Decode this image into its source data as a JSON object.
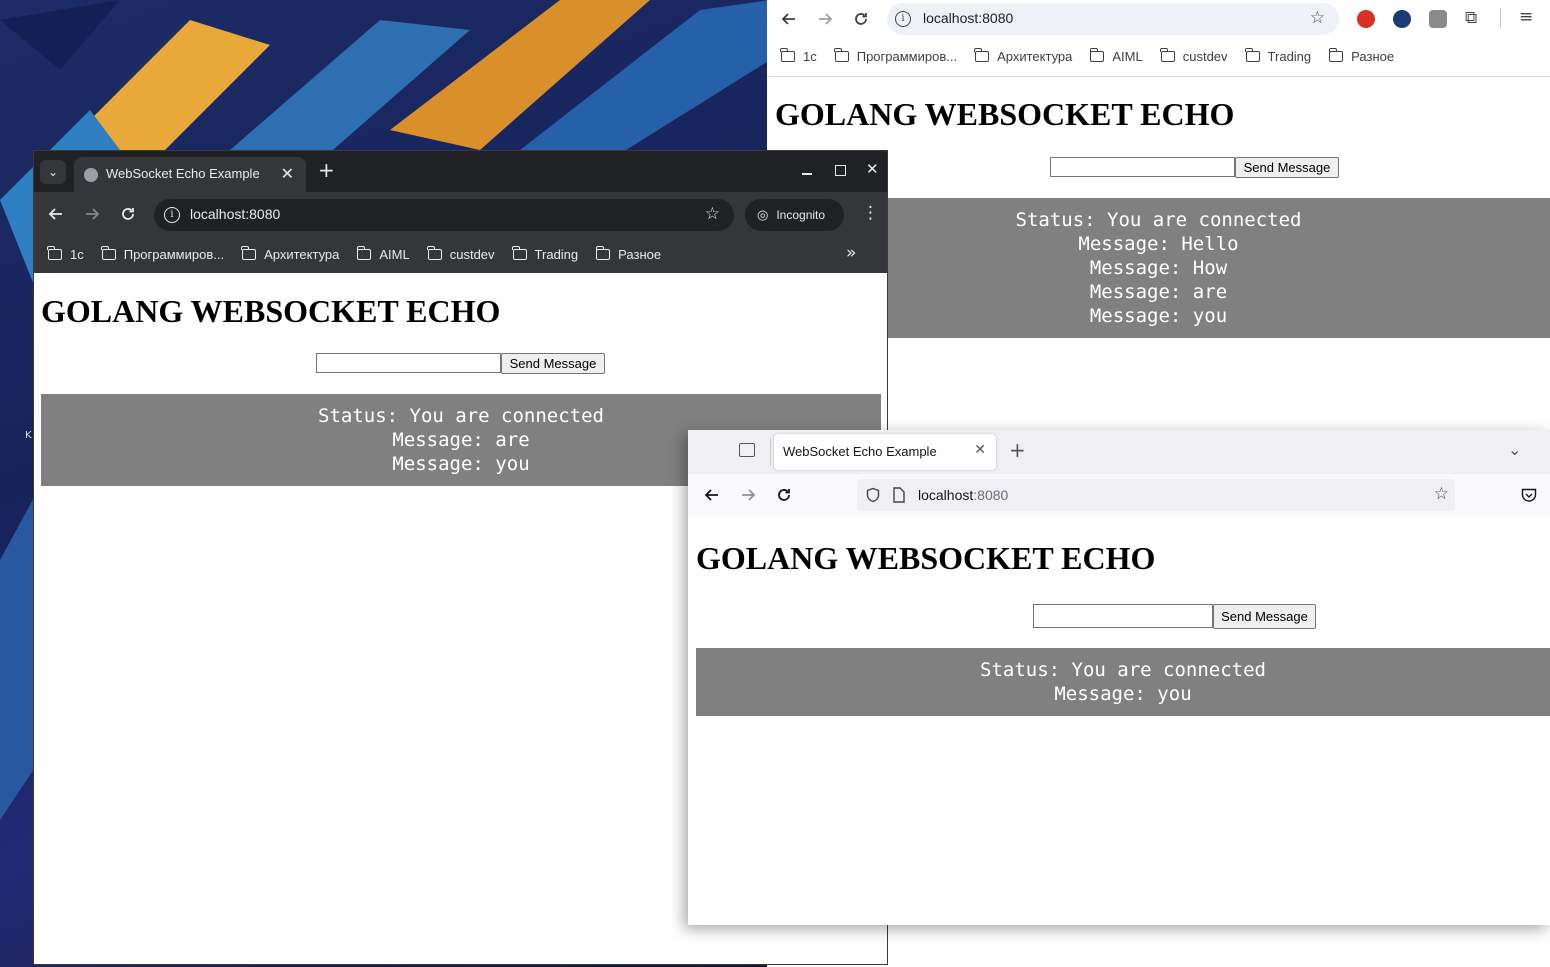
{
  "desktop": {
    "label": "K"
  },
  "page": {
    "heading": "GOLANG WEBSOCKET ECHO",
    "send_button": "Send Message",
    "input_value": ""
  },
  "bookmarks": [
    "1c",
    "Программиров...",
    "Архитектура",
    "AIML",
    "custdev",
    "Trading",
    "Разное"
  ],
  "chrome_right": {
    "url": "localhost:8080",
    "messages": [
      "Status: You are connected",
      "Message: Hello",
      "Message: How",
      "Message: are",
      "Message: you"
    ]
  },
  "chrome_incognito": {
    "tab_title": "WebSocket Echo Example",
    "url": "localhost:8080",
    "incognito_label": "Incognito",
    "more_bookmarks": "»",
    "messages": [
      "Status: You are connected",
      "Message: are",
      "Message: you"
    ]
  },
  "firefox": {
    "tab_title": "WebSocket Echo Example",
    "url_host": "localhost",
    "url_port": ":8080",
    "messages": [
      "Status: You are connected",
      "Message: you"
    ]
  },
  "colors": {
    "output_bg": "#808080",
    "incognito_frame": "#35363a",
    "firefox_frame": "#f0f0f4"
  }
}
